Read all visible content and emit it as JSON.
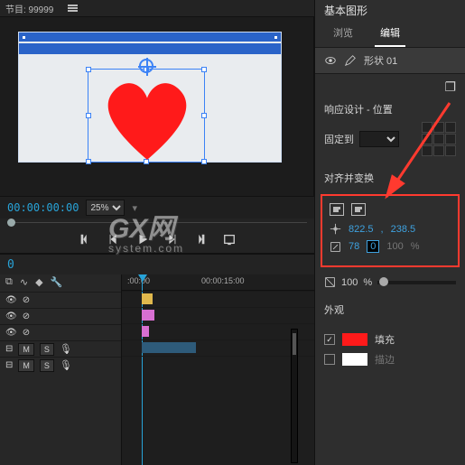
{
  "header": {
    "project_label": "节目: 99999"
  },
  "preview": {
    "timecode": "00:00:00:00",
    "zoom": "25%"
  },
  "right": {
    "panel_title": "基本图形",
    "tabs": {
      "browse": "浏览",
      "edit": "编辑"
    },
    "layer": {
      "name": "形状 01"
    },
    "responsive": {
      "title": "响应设计 - 位置",
      "pin_label": "固定到"
    },
    "align": {
      "title": "对齐并变换",
      "pos_x": "822.5",
      "pos_sep": ",",
      "pos_y": "238.5",
      "scale_a": "78",
      "scale_b": "0",
      "scale_unit": "100",
      "pct": "%"
    },
    "opacity": {
      "value": "100",
      "pct": "%"
    },
    "appearance": {
      "title": "外观",
      "fill": "填充",
      "stroke": "描边",
      "fill_color": "#ff1a1a",
      "stroke_color": "#ffffff"
    }
  },
  "timeline": {
    "time": "0",
    "ruler_a": ":00:00",
    "ruler_b": "00:00:15:00",
    "tracks": {
      "m": "M",
      "s": "S"
    }
  },
  "watermark": {
    "big": "GX网",
    "sub": "system.com"
  }
}
